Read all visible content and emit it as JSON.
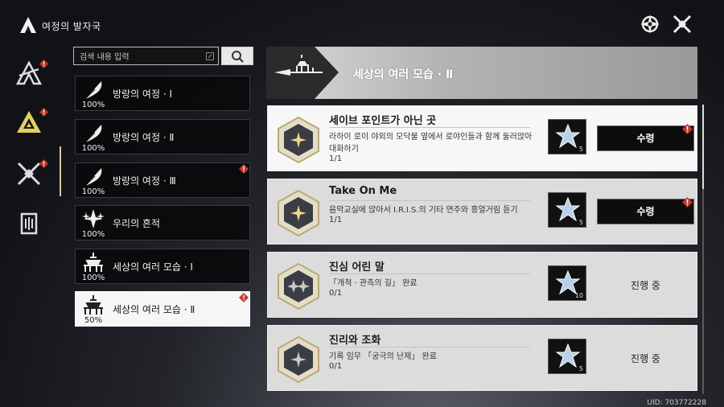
{
  "header": {
    "title": "여정의 발자국"
  },
  "search": {
    "placeholder": "검색 내용 입력"
  },
  "categories": [
    {
      "label": "방랑의 여정 · Ⅰ",
      "progress": "100%",
      "alert": false
    },
    {
      "label": "방랑의 여정 · Ⅱ",
      "progress": "100%",
      "alert": false
    },
    {
      "label": "방랑의 여정 · Ⅲ",
      "progress": "100%",
      "alert": true
    },
    {
      "label": "우리의 흔적",
      "progress": "100%",
      "alert": false
    },
    {
      "label": "세상의 여러 모습 · Ⅰ",
      "progress": "100%",
      "alert": false
    },
    {
      "label": "세상의 여러 모습 · Ⅱ",
      "progress": "50%",
      "alert": true
    }
  ],
  "section": {
    "title": "세상의 여러 모습 · Ⅱ"
  },
  "quests": [
    {
      "title": "세이브 포인트가 아닌 곳",
      "description": "라하이 로이 야외의 모닥불 옆에서 로야인들과 함께 둘러앉아 대화하기",
      "progress": "1/1",
      "reward_qty": "5",
      "action": "수령",
      "completed": true
    },
    {
      "title": "Take On Me",
      "description": "음악교실에 앉아서 I.R.I.S.의 기타 연주와 흥얼거림 듣기",
      "progress": "1/1",
      "reward_qty": "5",
      "action": "수령",
      "completed": true
    },
    {
      "title": "진심 어린 말",
      "description": "「개척 · 관측의 길」 완료",
      "progress": "0/1",
      "reward_qty": "10",
      "action": "진행 중",
      "completed": false
    },
    {
      "title": "진리와 조화",
      "description": "기록 임무 「궁극의 난제」 완료",
      "progress": "0/1",
      "reward_qty": "5",
      "action": "진행 중",
      "completed": false
    }
  ],
  "footer": {
    "uid": "UID: 703772228"
  },
  "colors": {
    "accent": "#d8c89c",
    "alert": "#c0392b",
    "card": "#dcdcdc"
  }
}
